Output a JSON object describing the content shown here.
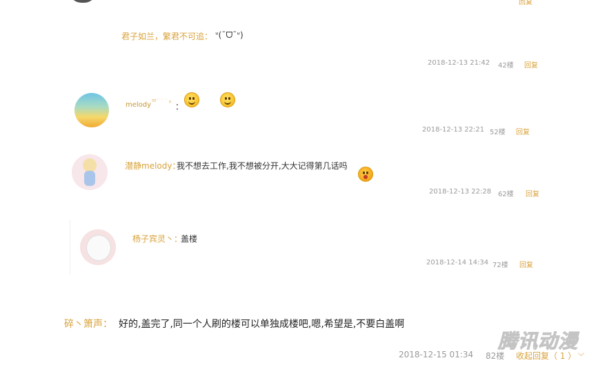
{
  "comments": [
    {
      "author": "君子如兰，繁君不可追：",
      "text": "ᐡ(¯ᗜ¯ᐡ)",
      "date": "2018-12-13 21:42",
      "floor": "42楼",
      "reply": "回复"
    },
    {
      "author": "melody",
      "author_suffix": "ºº˙˙˙ ˙ ₄",
      "colon": "：",
      "date": "2018-12-13 22:21",
      "floor": "52楼",
      "reply": "回复"
    },
    {
      "author": "潜静melody：",
      "text": "我不想去工作,我不想被分开,大大记得第几话吗",
      "date": "2018-12-13 22:28",
      "floor": "62楼",
      "reply": "回复"
    },
    {
      "author": "杨子宾灵丶：",
      "text": "盖楼",
      "date": "2018-12-14 14:34",
      "floor": "72楼",
      "reply": "回复"
    },
    {
      "author": "碎丶箫声：",
      "text": "好的,盖完了,同一个人刷的楼可以单独成楼吧,嗯,希望是,不要白盖啊",
      "date": "2018-12-15 01:34",
      "floor": "82楼",
      "collapse": "收起回复（ 1 ）"
    }
  ],
  "top_partial": {
    "reply": "回复"
  },
  "watermark": "腾讯动漫",
  "colors": {
    "accent": "#d9a23a",
    "meta": "#999999"
  }
}
